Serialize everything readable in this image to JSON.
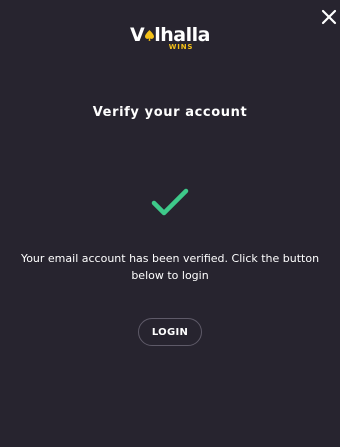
{
  "logo": {
    "main_prefix": "V",
    "main_suffix": "lhalla",
    "sub": "WINS"
  },
  "close_icon": "close-icon",
  "title": "Verify your account",
  "status_icon": "checkmark-icon",
  "message": "Your email account has been verified. Click the button below to login",
  "login_button": "LOGIN",
  "colors": {
    "background": "#27242f",
    "accent_check": "#3ec98a",
    "logo_accent": "#f3c019",
    "button_border": "#5e5a68"
  }
}
